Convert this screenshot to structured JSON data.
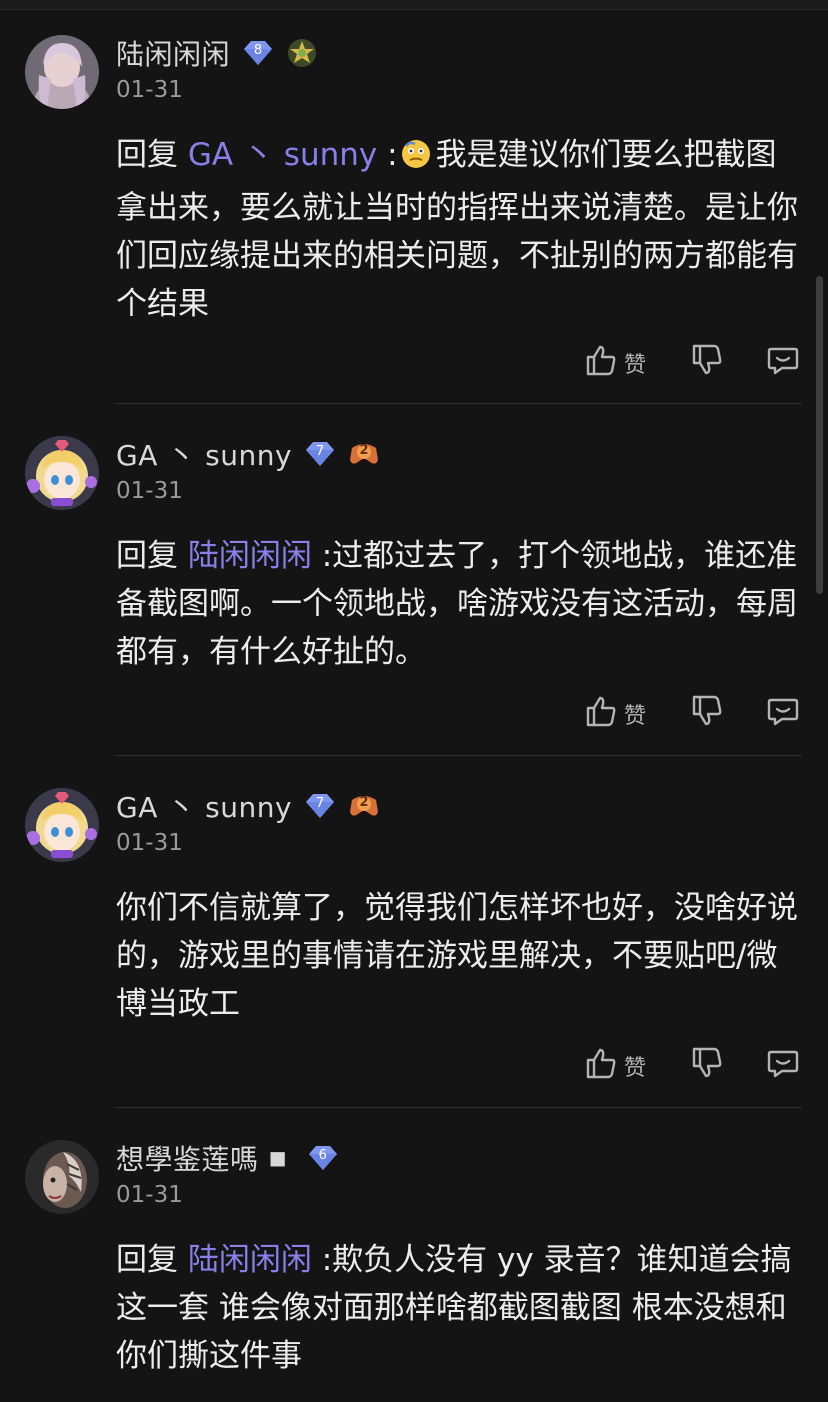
{
  "comments": [
    {
      "username": "陆闲闲闲",
      "level": "8",
      "date": "01-31",
      "reply_label": "回复",
      "mention": "GA 丶 sunny",
      "separator": " :",
      "text": "我是建议你们要么把截图拿出来，要么就让当时的指挥出来说清楚。是让你们回应缘提出来的相关问题，不扯别的两方都能有个结果",
      "emoji": "thinking-face-emoji",
      "like_label": "赞"
    },
    {
      "username": "GA 丶 sunny",
      "level": "7",
      "game_badge": "2",
      "date": "01-31",
      "reply_label": "回复",
      "mention": "陆闲闲闲",
      "separator": " :",
      "text": "过都过去了，打个领地战，谁还准备截图啊。一个领地战，啥游戏没有这活动，每周都有，有什么好扯的。",
      "like_label": "赞"
    },
    {
      "username": "GA 丶 sunny",
      "level": "7",
      "game_badge": "2",
      "date": "01-31",
      "text": "你们不信就算了，觉得我们怎样坏也好，没啥好说的，游戏里的事情请在游戏里解决，不要贴吧/微博当政工",
      "like_label": "赞"
    },
    {
      "username": "想學鉴莲嗎",
      "username_suffix": "◼",
      "level": "6",
      "date": "01-31",
      "reply_label": "回复",
      "mention": "陆闲闲闲",
      "separator": " :",
      "text": "欺负人没有 yy 录音？谁知道会搞这一套 谁会像对面那样啥都截图截图 根本没想和你们撕这件事"
    }
  ],
  "colors": {
    "background": "#141414",
    "mention": "#8c7ee8",
    "level_badge": "#7f97f2"
  }
}
